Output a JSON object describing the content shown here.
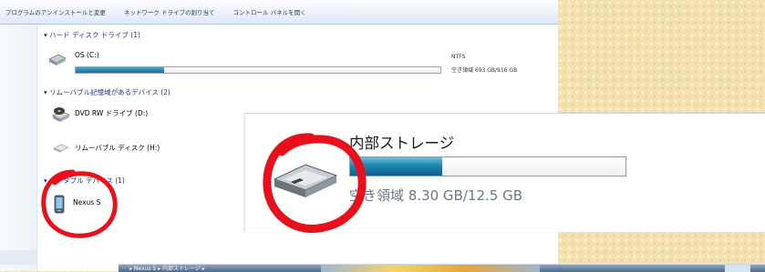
{
  "toolbar": {
    "uninstall": "プログラムのアンインストールと変更",
    "map_drive": "ネットワーク ドライブの割り当て",
    "control_panel": "コントロール パネルを開く"
  },
  "groups": {
    "hdd_header": "ハード ディスク ドライブ (1)",
    "removable_header": "リムーバブル記憶域があるデバイス (2)",
    "portable_header": "ポータブル デバイス (1)"
  },
  "drives": {
    "os": {
      "label": "OS (C:)",
      "filesystem": "NTFS",
      "free": "空き領域 693 GB/916 GB",
      "used_fraction": 0.243
    },
    "dvd": {
      "label": "DVD RW ドライブ (D:)"
    },
    "removable": {
      "label": "リムーバブル ディスク (H:)"
    },
    "nexus": {
      "label": "Nexus S"
    }
  },
  "zoom": {
    "title": "内部ストレージ",
    "free": "空き領域 8.30 GB/12.5 GB",
    "used_fraction": 0.336
  },
  "taskbar": {
    "breadcrumb": "▸ Nexus S ▸ 内部ストレージ ▸"
  },
  "colors": {
    "background": "#f3e2b0",
    "progress": "#1a6e9b",
    "annotation": "#e8101a",
    "group_header": "#1e3287"
  },
  "icons": {
    "hdd": "hard-disk-icon",
    "dvd": "dvd-drive-icon",
    "removable": "removable-disk-icon",
    "phone": "phone-icon",
    "storage": "storage-icon"
  }
}
